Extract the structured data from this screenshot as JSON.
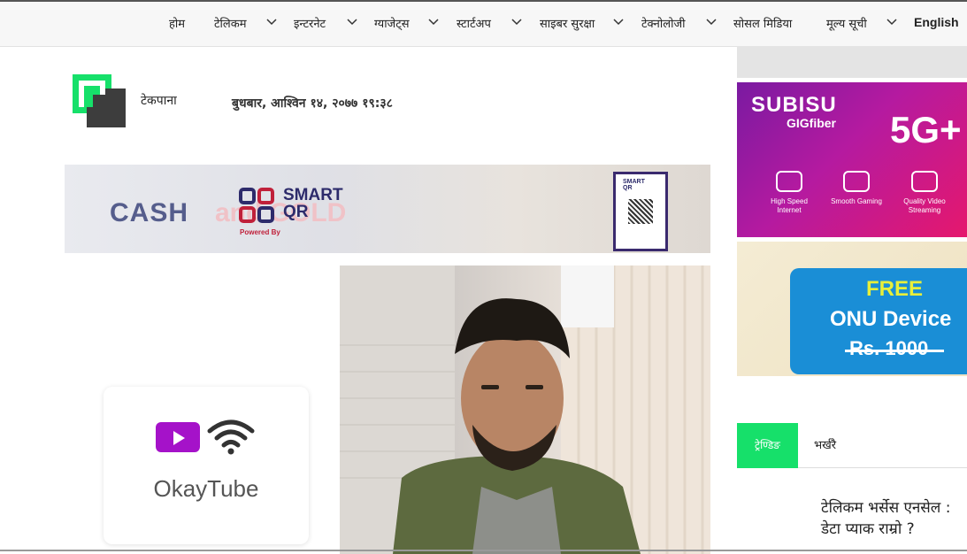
{
  "nav": {
    "items": [
      "होम",
      "टेलिकम",
      "इन्टरनेट",
      "ग्याजेट्स",
      "स्टार्टअप",
      "साइबर सुरक्षा",
      "टेक्नोलोजी",
      "सोसल मिडिया",
      "मूल्य सूची"
    ],
    "english_label": "English"
  },
  "header": {
    "site_name": "टेकपाना",
    "date": "बुधबार, आश्विन १४, २०७७ १९:३८"
  },
  "ad_banner": {
    "cash": "CASH",
    "faded_text": "and GOLD",
    "smart": "SMART",
    "qr": "QR",
    "powered_by": "Powered By",
    "stand_title_1": "SMART",
    "stand_title_2": "QR"
  },
  "app_card": {
    "name": "OkayTube"
  },
  "sidebar_ad_subisu": {
    "brand": "SUBISU",
    "product": "GIGfiber",
    "badge": "5G+",
    "features": [
      "High Speed Internet",
      "Smooth Gaming",
      "Quality Video Streaming"
    ]
  },
  "sidebar_ad_onu": {
    "free": "FREE",
    "device": "ONU Device",
    "price": "Rs. 1000"
  },
  "tabs": {
    "trending": "ट्रेण्डिङ",
    "latest": "भर्खरै"
  },
  "trending": {
    "first_title": "टेलिकम भर्सेस एनसेल : डेटा प्याक राम्रो ?"
  },
  "colors": {
    "accent_green": "#16e06a",
    "youtube_purple": "#a512c9",
    "subisu_gradient_start": "#7a1aa1",
    "onu_blue": "#1a8ed6"
  }
}
